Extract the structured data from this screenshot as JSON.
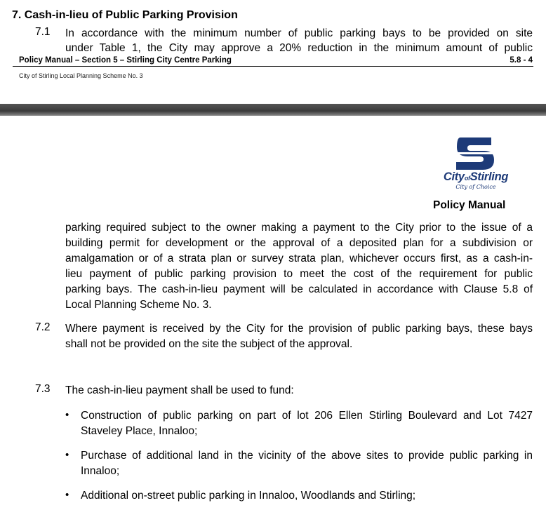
{
  "page1": {
    "heading": "7.   Cash-in-lieu of Public Parking Provision",
    "clause_7_1_num": "7.1",
    "clause_7_1_line1": "In accordance with the minimum number of public parking bays to be provided on site",
    "clause_7_1_line2": "under Table 1, the City may approve a 20% reduction in the minimum amount of public",
    "footer_title": "Policy Manual – Section 5 – Stirling City Centre Parking",
    "footer_page": "5.8 - 4",
    "footer_scheme": "City of Stirling Local Planning Scheme No. 3"
  },
  "page2": {
    "logo_name_city": "City",
    "logo_name_of": "of",
    "logo_name_stirling": "Stirling",
    "logo_tagline": "City of Choice",
    "policy_manual": "Policy Manual",
    "clause_7_1_continued": [
      "parking required subject to the owner making a payment to the City prior to the issue of a",
      "building permit for development or the approval of a deposited plan for a subdivision or",
      "amalgamation or of a strata plan or survey strata plan, whichever occurs first, as a cash-in-",
      "lieu payment of public parking provision to meet the cost of the requirement for public",
      "parking bays.  The cash-in-lieu payment will be calculated in accordance with Clause 5.8 of",
      "Local Planning Scheme No. 3."
    ],
    "clause_7_2_num": "7.2",
    "clause_7_2_lines": [
      "Where payment is received by the City for the provision of public parking bays, these bays",
      "shall not be provided on the site the subject of the approval."
    ],
    "clause_7_3_num": "7.3",
    "clause_7_3_text": "The cash-in-lieu payment shall be used to fund:",
    "bullets": [
      [
        "Construction of public parking on part of lot 206 Ellen Stirling Boulevard and Lot 7427",
        "Staveley Place, Innaloo;"
      ],
      [
        "Purchase of additional land in the vicinity of the above sites to provide public parking in",
        "Innaloo;"
      ],
      [
        "Additional on-street public parking in Innaloo, Woodlands and Stirling;"
      ]
    ],
    "bullet_symbol": "•",
    "logo_color": "#1d3a78"
  }
}
